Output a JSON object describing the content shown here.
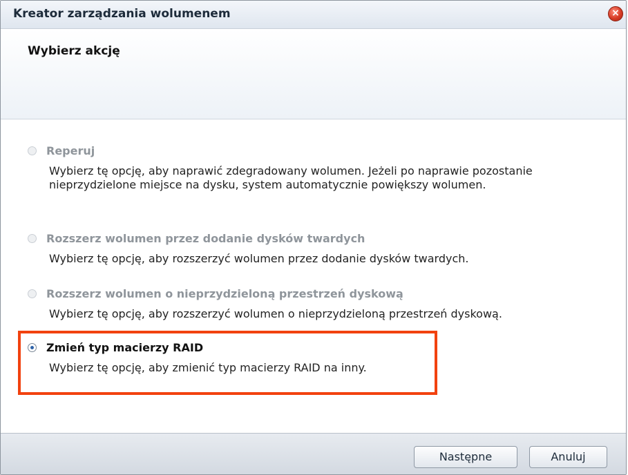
{
  "window": {
    "title": "Kreator zarządzania wolumenem",
    "close_glyph": "×"
  },
  "step": {
    "title": "Wybierz akcję"
  },
  "options": [
    {
      "label": "Reperuj",
      "description": "Wybierz tę opcję, aby naprawić zdegradowany wolumen. Jeżeli po naprawie pozostanie nieprzydzielone miejsce na dysku, system automatycznie powiększy wolumen.",
      "selected": false,
      "enabled": false
    },
    {
      "label": "Rozszerz wolumen przez dodanie dysków twardych",
      "description": "Wybierz tę opcję, aby rozszerzyć wolumen przez dodanie dysków twardych.",
      "selected": false,
      "enabled": false
    },
    {
      "label": "Rozszerz wolumen o nieprzydzieloną przestrzeń dyskową",
      "description": "Wybierz tę opcję, aby rozszerzyć wolumen o nieprzydzieloną przestrzeń dyskową.",
      "selected": false,
      "enabled": false
    },
    {
      "label": "Zmień typ macierzy RAID",
      "description": "Wybierz tę opcję, aby zmienić typ macierzy RAID na inny.",
      "selected": true,
      "enabled": true
    }
  ],
  "footer": {
    "next_label": "Następne",
    "cancel_label": "Anuluj"
  },
  "colors": {
    "highlight": "#f2420f",
    "close": "#d63b25",
    "disabled_text": "#8f959b"
  },
  "icons": {
    "close": "close-icon",
    "radio": "radio-button-icon"
  }
}
